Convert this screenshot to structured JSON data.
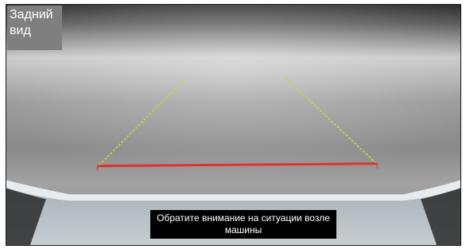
{
  "screen": {
    "title": "Задний\nвид",
    "notice": "Обратите внимание на ситуации возле машины"
  },
  "guide_lines": {
    "side_line_color": "#c8d24a",
    "bottom_line_color": "#e0322f"
  },
  "icons": []
}
